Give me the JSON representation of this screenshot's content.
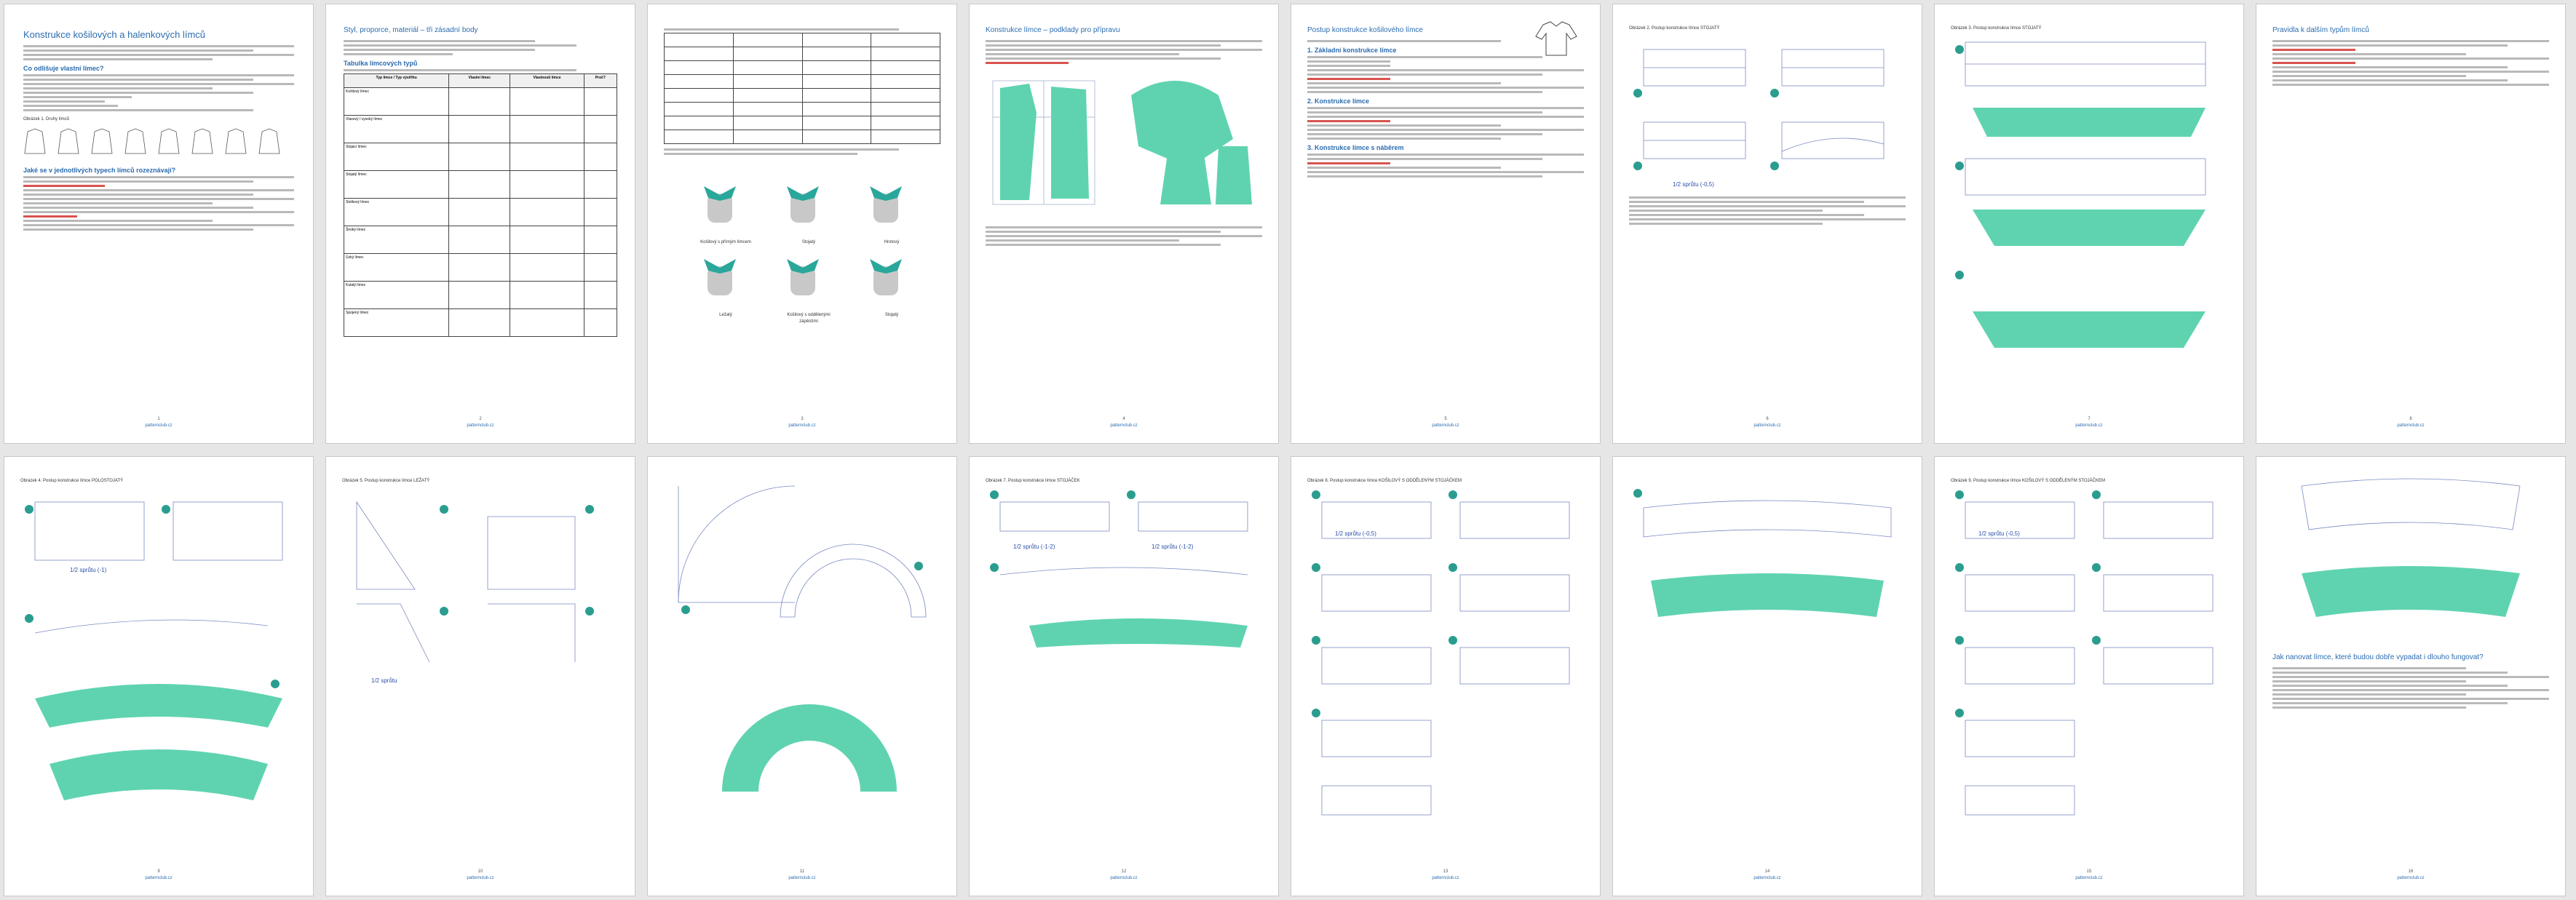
{
  "document": {
    "pages": [
      {
        "title": "Konstrukce košilových a halenkových límců",
        "intro_heading": "Co odlišuje vlastní límec?",
        "subheading": "Jaké se v jednotlivých typech límců rozeznávají?",
        "figure_caption": "Obrázek 1. Druhy límců",
        "page_number": "1",
        "footer_link": "patternclub.cz"
      },
      {
        "title": "Styl, proporce, materiál – tři zásadní body",
        "subheading": "Tabulka límcových typů",
        "page_number": "2",
        "footer_link": "patternclub.cz",
        "table_headers": [
          "Typ límce / Typ výstřihu",
          "Vlastní límec",
          "Vlastnosti límce",
          "Proč?"
        ],
        "table_rows": [
          "Košilový límec",
          "Vlasový / vysoký límec",
          "Stojací límec",
          "Stojatý límec",
          "Stolkový límec",
          "Široký límec",
          "Úzký límec",
          "Kulatý límec",
          "Spojený límec"
        ]
      },
      {
        "caption_1": "Košilový s přímým límcem",
        "caption_2": "Stojatý",
        "caption_3": "Hrotový",
        "caption_4": "Ležatý",
        "caption_5": "Košilový s oddělenými zápěstími",
        "caption_6": "Stojatý",
        "page_number": "3",
        "footer_link": "patternclub.cz"
      },
      {
        "title": "Konstrukce límce – podklady pro přípravu",
        "page_number": "4",
        "footer_link": "patternclub.cz"
      },
      {
        "title": "Postup konstrukce košilového límce",
        "subheading": "1. Základní konstrukce límce",
        "step_2": "2. Konstrukce límce",
        "step_3": "3. Konstrukce límce s náběrem",
        "page_number": "5",
        "footer_link": "patternclub.cz"
      },
      {
        "chapter": "Obrázek 2. Postup konstrukce límce STOJATÝ",
        "label": "1/2 sprůtu (-0,5)",
        "page_number": "6",
        "footer_link": "patternclub.cz"
      },
      {
        "chapter": "Obrázek 3. Postup konstrukce límce STOJATÝ",
        "label": "1/2 sprůtu (-0,5)",
        "page_number": "7",
        "footer_link": "patternclub.cz"
      },
      {
        "title": "Pravidla k dalším typům límců",
        "page_number": "8",
        "footer_link": "patternclub.cz"
      },
      {
        "chapter": "Obrázek 4. Postup konstrukce límce POLOSTOJATÝ",
        "label": "1/2 sprůtu (-1)",
        "page_number": "9",
        "footer_link": "patternclub.cz"
      },
      {
        "chapter": "Obrázek 5. Postup konstrukce límce LEŽATÝ",
        "label": "1/2 sprůtu",
        "page_number": "10",
        "footer_link": "patternclub.cz"
      },
      {
        "page_number": "11",
        "footer_link": "patternclub.cz"
      },
      {
        "chapter": "Obrázek 7. Postup konstrukce límce STOJÁČEK",
        "label_1": "1/2 sprůtu (-1-2)",
        "label_2": "1/2 sprůtu (-1-2)",
        "page_number": "12",
        "footer_link": "patternclub.cz"
      },
      {
        "chapter": "Obrázek 8. Postup konstrukce límce KOŠILOVÝ S ODDĚLENÝM STOJÁČKEM",
        "label": "1/2 sprůtu (-0,5)",
        "page_number": "13",
        "footer_link": "patternclub.cz"
      },
      {
        "page_number": "14",
        "footer_link": "patternclub.cz"
      },
      {
        "chapter": "Obrázek 9. Postup konstrukce límce KOŠILOVÝ S ODDĚLENÝM STOJÁČKEM",
        "label": "1/2 sprůtu (-0,5)",
        "page_number": "15",
        "footer_link": "patternclub.cz"
      },
      {
        "title": "Jak nanovat límce, které budou dobře vypadat i dlouho fungovat?",
        "page_number": "16",
        "footer_link": "patternclub.cz"
      }
    ]
  },
  "colors": {
    "accent": "#2b6cb0",
    "pattern_fill": "#5fd3b0",
    "highlight": "#d9534f",
    "marker": "#2a9d8f"
  }
}
